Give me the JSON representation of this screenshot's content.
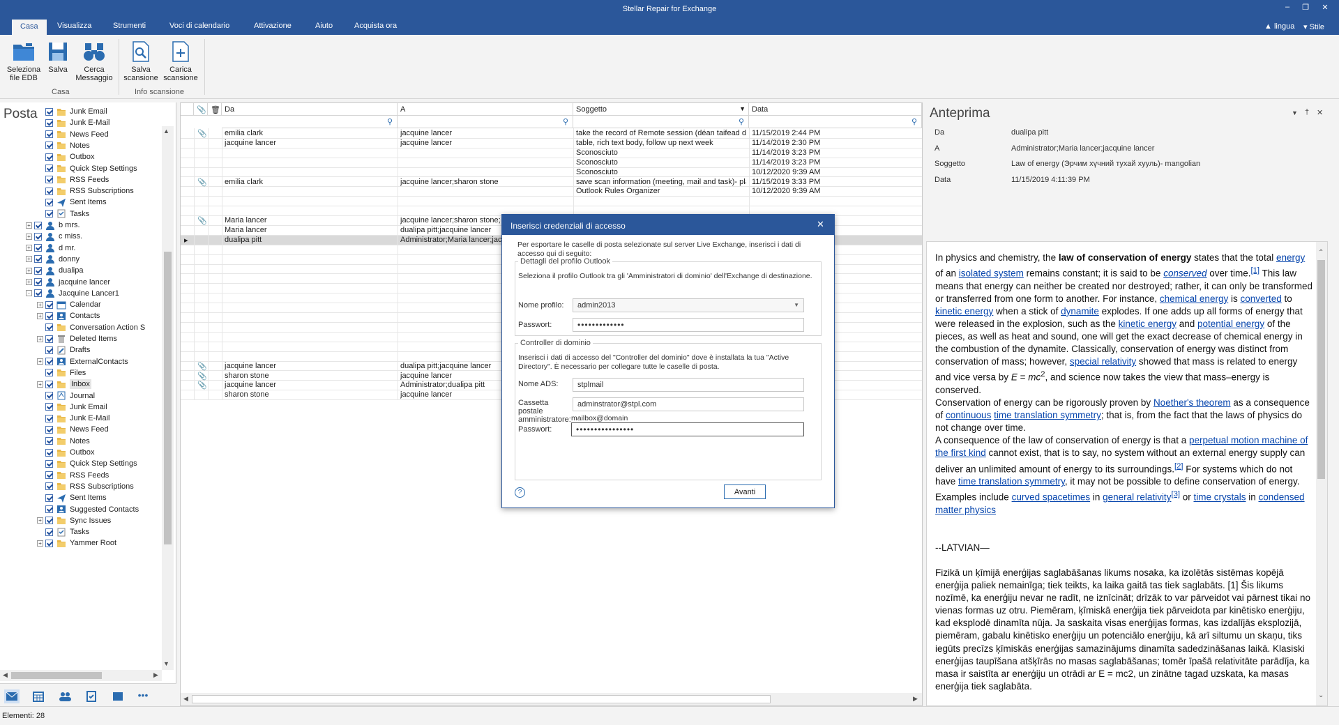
{
  "app": {
    "title": "Stellar Repair for Exchange",
    "status": "Elementi: 28"
  },
  "menu": {
    "tabs": [
      "Casa",
      "Visualizza",
      "Strumenti",
      "Voci di calendario",
      "Attivazione",
      "Aiuto",
      "Acquista ora"
    ],
    "right": [
      "lingua",
      "Stile"
    ]
  },
  "ribbon": {
    "groups": [
      {
        "label": "Casa",
        "buttons": [
          "Seleziona file EDB",
          "Salva",
          "Cerca Messaggio"
        ]
      },
      {
        "label": "Info scansione",
        "buttons": [
          "Salva scansione",
          "Carica scansione"
        ]
      }
    ]
  },
  "leftpane": {
    "title": "Posta",
    "tree": [
      {
        "label": "Junk Email",
        "icon": "folder",
        "level": 2
      },
      {
        "label": "Junk E-Mail",
        "icon": "folder",
        "level": 2
      },
      {
        "label": "News Feed",
        "icon": "folder",
        "level": 2
      },
      {
        "label": "Notes",
        "icon": "folder",
        "level": 2
      },
      {
        "label": "Outbox",
        "icon": "folder",
        "level": 2
      },
      {
        "label": "Quick Step Settings",
        "icon": "folder",
        "level": 2
      },
      {
        "label": "RSS Feeds",
        "icon": "folder",
        "level": 2
      },
      {
        "label": "RSS Subscriptions",
        "icon": "folder",
        "level": 2
      },
      {
        "label": "Sent Items",
        "icon": "sent",
        "level": 2
      },
      {
        "label": "Tasks",
        "icon": "tasks",
        "level": 2
      },
      {
        "label": "b mrs.",
        "icon": "user",
        "level": 1,
        "expander": "+"
      },
      {
        "label": "c miss.",
        "icon": "user",
        "level": 1,
        "expander": "+"
      },
      {
        "label": "d mr.",
        "icon": "user",
        "level": 1,
        "expander": "+"
      },
      {
        "label": "donny",
        "icon": "user",
        "level": 1,
        "expander": "+"
      },
      {
        "label": "dualipa",
        "icon": "user",
        "level": 1,
        "expander": "+"
      },
      {
        "label": "jacquine lancer",
        "icon": "user",
        "level": 1,
        "expander": "+"
      },
      {
        "label": "Jacquine Lancer1",
        "icon": "user",
        "level": 1,
        "expander": "-"
      },
      {
        "label": "Calendar",
        "icon": "calendar",
        "level": 2,
        "expander": "+"
      },
      {
        "label": "Contacts",
        "icon": "contacts",
        "level": 2,
        "expander": "+"
      },
      {
        "label": "Conversation Action S",
        "icon": "folder",
        "level": 2
      },
      {
        "label": "Deleted Items",
        "icon": "trash",
        "level": 2,
        "expander": "+"
      },
      {
        "label": "Drafts",
        "icon": "drafts",
        "level": 2
      },
      {
        "label": "ExternalContacts",
        "icon": "contacts",
        "level": 2,
        "expander": "+"
      },
      {
        "label": "Files",
        "icon": "folder",
        "level": 2
      },
      {
        "label": "Inbox",
        "icon": "folder",
        "level": 2,
        "expander": "+",
        "selected": true
      },
      {
        "label": "Journal",
        "icon": "journal",
        "level": 2
      },
      {
        "label": "Junk Email",
        "icon": "folder",
        "level": 2
      },
      {
        "label": "Junk E-Mail",
        "icon": "folder",
        "level": 2
      },
      {
        "label": "News Feed",
        "icon": "folder",
        "level": 2
      },
      {
        "label": "Notes",
        "icon": "folder",
        "level": 2
      },
      {
        "label": "Outbox",
        "icon": "folder",
        "level": 2
      },
      {
        "label": "Quick Step Settings",
        "icon": "folder",
        "level": 2
      },
      {
        "label": "RSS Feeds",
        "icon": "folder",
        "level": 2
      },
      {
        "label": "RSS Subscriptions",
        "icon": "folder",
        "level": 2
      },
      {
        "label": "Sent Items",
        "icon": "sent",
        "level": 2
      },
      {
        "label": "Suggested Contacts",
        "icon": "contacts",
        "level": 2
      },
      {
        "label": "Sync Issues",
        "icon": "folder",
        "level": 2,
        "expander": "+"
      },
      {
        "label": "Tasks",
        "icon": "tasks",
        "level": 2
      },
      {
        "label": "Yammer Root",
        "icon": "folder",
        "level": 2,
        "expander": "+"
      }
    ]
  },
  "grid": {
    "columns": [
      "Da",
      "A",
      "Soggetto",
      "Data"
    ],
    "rows": [
      {
        "att": true,
        "from": "emilia clark",
        "to": "jacquine lancer",
        "subject": "take the record of Remote session (déan taifead d...",
        "date": "11/15/2019 2:44 PM"
      },
      {
        "att": false,
        "from": "jacquine lancer",
        "to": "jacquine lancer",
        "subject": "table, rich text body, follow up next week",
        "date": "11/14/2019 2:30 PM"
      },
      {
        "att": false,
        "from": "",
        "to": "",
        "subject": "Sconosciuto",
        "date": "11/14/2019 3:23 PM"
      },
      {
        "att": false,
        "from": "",
        "to": "",
        "subject": "Sconosciuto",
        "date": "11/14/2019 3:23 PM"
      },
      {
        "att": false,
        "from": "",
        "to": "",
        "subject": "Sconosciuto",
        "date": "10/12/2020 9:39 AM"
      },
      {
        "att": true,
        "from": "emilia clark",
        "to": "jacquine lancer;sharon stone",
        "subject": "save scan information (meeting, mail and task)- pla...",
        "date": "11/15/2019 3:33 PM"
      },
      {
        "att": false,
        "from": "",
        "to": "",
        "subject": "Outlook Rules Organizer",
        "date": "10/12/2020 9:39 AM"
      },
      {
        "att": false,
        "from": "",
        "to": "",
        "subject": "",
        "date": ""
      },
      {
        "att": false,
        "from": "",
        "to": "",
        "subject": "",
        "date": ""
      },
      {
        "att": true,
        "from": "Maria lancer",
        "to": "jacquine lancer;sharon stone;",
        "subject": "",
        "date": ""
      },
      {
        "att": false,
        "from": "Maria lancer",
        "to": "dualipa pitt;jacquine lancer",
        "subject": "",
        "date": ""
      },
      {
        "att": false,
        "from": "dualipa pitt",
        "to": "Administrator;Maria lancer;jac",
        "subject": "",
        "date": "",
        "selected": true
      },
      {
        "att": false,
        "from": "",
        "to": "",
        "subject": "",
        "date": ""
      },
      {
        "att": false,
        "from": "",
        "to": "",
        "subject": "",
        "date": ""
      },
      {
        "att": false,
        "from": "",
        "to": "",
        "subject": "",
        "date": ""
      },
      {
        "att": false,
        "from": "",
        "to": "",
        "subject": "",
        "date": ""
      },
      {
        "att": false,
        "from": "",
        "to": "",
        "subject": "",
        "date": ""
      },
      {
        "att": false,
        "from": "",
        "to": "",
        "subject": "",
        "date": ""
      },
      {
        "att": false,
        "from": "",
        "to": "",
        "subject": "",
        "date": ""
      },
      {
        "att": false,
        "from": "",
        "to": "",
        "subject": "",
        "date": ""
      },
      {
        "att": false,
        "from": "",
        "to": "",
        "subject": "",
        "date": ""
      },
      {
        "att": false,
        "from": "",
        "to": "",
        "subject": "",
        "date": ""
      },
      {
        "att": false,
        "from": "",
        "to": "",
        "subject": "",
        "date": ""
      },
      {
        "att": false,
        "from": "",
        "to": "",
        "subject": "",
        "date": ""
      },
      {
        "att": true,
        "from": "jacquine lancer",
        "to": "dualipa pitt;jacquine lancer",
        "subject": "",
        "date": ""
      },
      {
        "att": true,
        "from": "sharon stone",
        "to": "jacquine lancer",
        "subject": "",
        "date": ""
      },
      {
        "att": true,
        "from": "jacquine lancer",
        "to": "Administrator;dualipa pitt",
        "subject": "",
        "date": ""
      },
      {
        "att": false,
        "from": "sharon stone",
        "to": "jacquine lancer",
        "subject": "",
        "date": ""
      }
    ]
  },
  "preview": {
    "title": "Anteprima",
    "fields": [
      {
        "label": "Da",
        "value": "dualipa pitt"
      },
      {
        "label": "A",
        "value": "Administrator;Maria lancer;jacquine lancer"
      },
      {
        "label": "Soggetto",
        "value": "Law of energy (Эрчим хүчний тухай хууль)- mangolian"
      },
      {
        "label": "Data",
        "value": "11/15/2019 4:11:39 PM"
      }
    ],
    "latvian_heading": "--LATVIAN—",
    "latvian_text": "Fizikā un ķīmijā enerģijas saglabāšanas likums nosaka, ka izolētās sistēmas kopējā enerģija paliek nemainīga; tiek teikts, ka laika gaitā tas tiek saglabāts. [1] Šis likums nozīmē, ka enerģiju nevar ne radīt, ne iznīcināt; drīzāk to var pārveidot vai pārnest tikai no vienas formas uz otru. Piemēram, ķīmiskā enerģija tiek pārveidota par kinētisko enerģiju, kad eksplodē dinamīta nūja. Ja saskaita visas enerģijas formas, kas izdalījās eksplozijā, piemēram, gabalu kinētisko enerģiju un potenciālo enerģiju, kā arī siltumu un skaņu, tiks iegūts precīzs ķīmiskās enerģijas samazinājums dinamīta sadedzināšanas laikā. Klasiski enerģijas taupīšana atšķīrās no masas saglabāšanas; tomēr īpašā relativitāte parādīja, ka masa ir saistīta ar enerģiju un otrādi ar E = mc2, un zinātne tagad uzskata, ka masas enerģija tiek saglabāta."
  },
  "dialog": {
    "title": "Inserisci credenziali di accesso",
    "intro": "Per esportare le caselle di posta selezionate sul server Live Exchange, inserisci i dati di accesso qui di seguito:",
    "section1_title": "Dettagli del profilo Outlook",
    "section1_desc": "Seleziona il profilo Outlook tra gli 'Amministratori di dominio' dell'Exchange di destinazione.",
    "profile_label": "Nome profilo:",
    "profile_value": "admin2013",
    "password_label": "Passwort:",
    "password1_value": "•••••••••••••",
    "section2_title": "Controller di dominio",
    "section2_desc": "Inserisci i dati di accesso del \"Controller del dominio\" dove è installata la tua \"Active Directory\". È necessario per collegare tutte le caselle di posta.",
    "ads_label": "Nome ADS:",
    "ads_value": "stplmail",
    "mailbox_label": "Cassetta postale amministratore:",
    "mailbox_value": "adminstrator@stpl.com",
    "mailbox_hint": "mailbox@domain",
    "password2_value": "••••••••••••••••",
    "next_button": "Avanti"
  },
  "colors": {
    "accent": "#2b579a",
    "folder": "#e8b84a",
    "selected_row": "#d9d9d9"
  }
}
